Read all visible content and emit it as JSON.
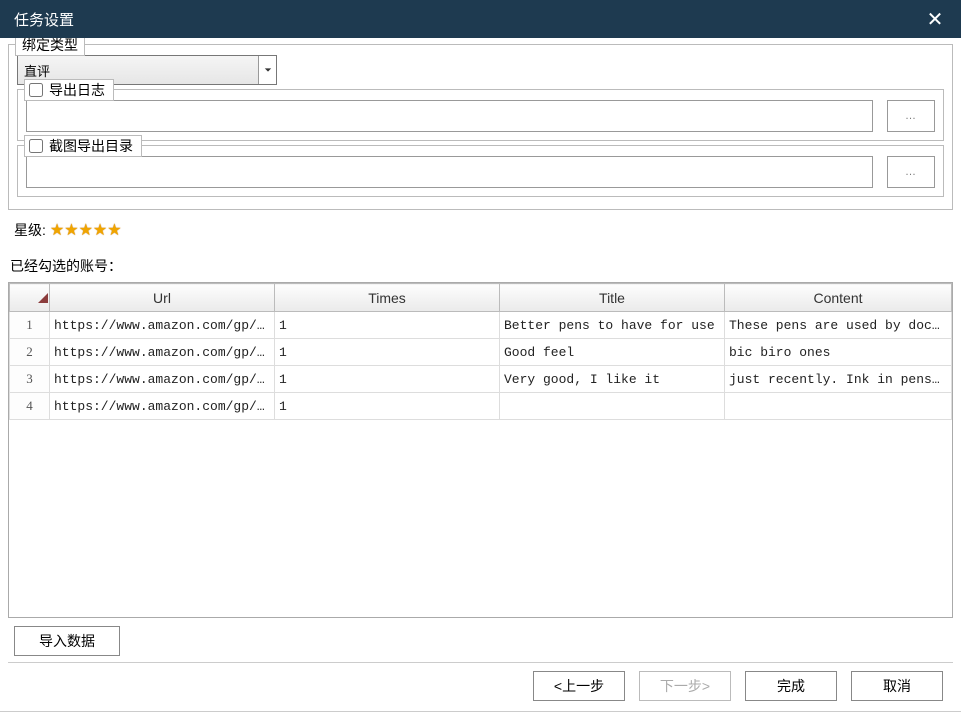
{
  "window": {
    "title": "任务设置"
  },
  "bindType": {
    "legend": "绑定类型",
    "selected": "直评"
  },
  "exportLog": {
    "legend": "导出日志",
    "path": "",
    "browse": "…"
  },
  "screenshotDir": {
    "legend": "截图导出目录",
    "path": "",
    "browse": "…"
  },
  "star": {
    "label": "星级:",
    "count": 5
  },
  "accountsLabel": "已经勾选的账号：",
  "table": {
    "headers": {
      "url": "Url",
      "times": "Times",
      "title": "Title",
      "content": "Content"
    },
    "rows": [
      {
        "n": "1",
        "url": "https://www.amazon.com/gp/...",
        "times": "1",
        "title": " Better pens to have for use",
        "content": "These pens are used by doc..."
      },
      {
        "n": "2",
        "url": "https://www.amazon.com/gp/...",
        "times": "1",
        "title": "Good feel",
        "content": "bic biro ones"
      },
      {
        "n": "3",
        "url": "https://www.amazon.com/gp/...",
        "times": "1",
        "title": "Very good, I like it",
        "content": "just recently. Ink in pens..."
      },
      {
        "n": "4",
        "url": "https://www.amazon.com/gp/...",
        "times": "1",
        "title": "",
        "content": ""
      }
    ]
  },
  "importBtn": "导入数据",
  "footer": {
    "prev": "<上一步",
    "next": "下一步>",
    "finish": "完成",
    "cancel": "取消"
  }
}
